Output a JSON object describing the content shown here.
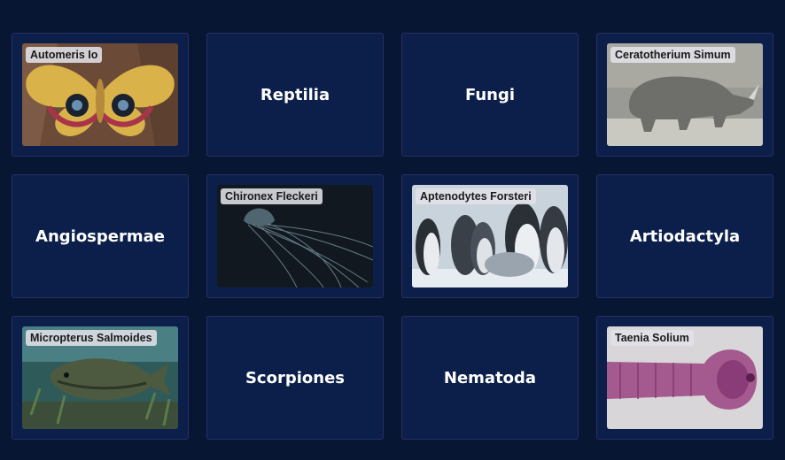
{
  "cards": [
    {
      "type": "image",
      "label": "Automeris Io",
      "image": "moth-photo"
    },
    {
      "type": "text",
      "label": "Reptilia"
    },
    {
      "type": "text",
      "label": "Fungi"
    },
    {
      "type": "image",
      "label": "Ceratotherium Simum",
      "image": "rhinoceros-photo"
    },
    {
      "type": "text",
      "label": "Angiospermae"
    },
    {
      "type": "image",
      "label": "Chironex Fleckeri",
      "image": "box-jellyfish-photo"
    },
    {
      "type": "image",
      "label": "Aptenodytes Forsteri",
      "image": "emperor-penguins-photo"
    },
    {
      "type": "text",
      "label": "Artiodactyla"
    },
    {
      "type": "image",
      "label": "Micropterus Salmoides",
      "image": "largemouth-bass-photo"
    },
    {
      "type": "text",
      "label": "Scorpiones"
    },
    {
      "type": "text",
      "label": "Nematoda"
    },
    {
      "type": "image",
      "label": "Taenia Solium",
      "image": "tapeworm-photo"
    }
  ],
  "colors": {
    "background": "#071733",
    "card": "#0b1f4a",
    "card_border": "#2c2d63",
    "label_text": "#ffffff"
  }
}
